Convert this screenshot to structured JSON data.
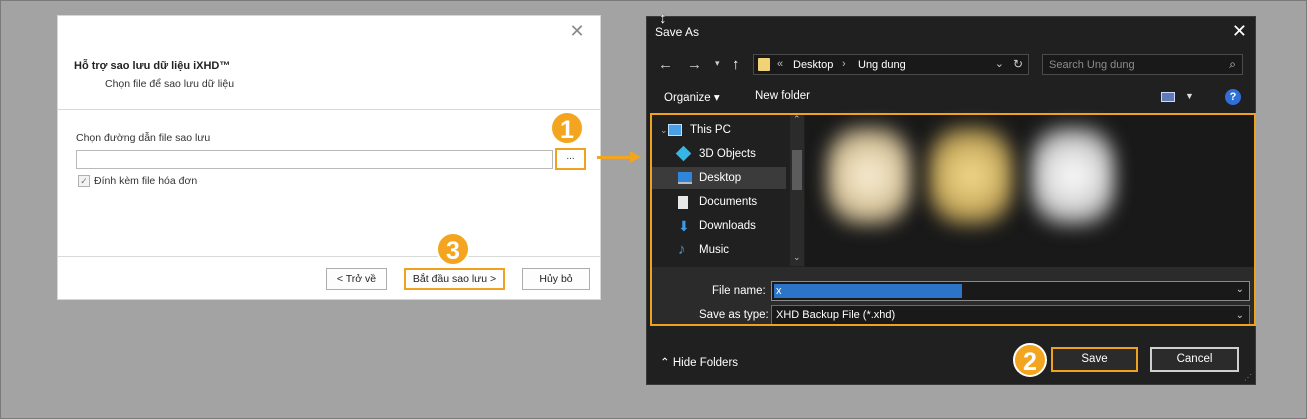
{
  "wizard": {
    "title": "Hỗ trợ sao lưu dữ liệu iXHD™",
    "subtitle": "Chọn file để sao lưu dữ liệu",
    "path_label": "Chọn đường dẫn file sao lưu",
    "path_value": "",
    "browse_label": "...",
    "attach_checked": true,
    "attach_label": "Đính kèm file hóa đơn",
    "back_label": "< Trở về",
    "start_label": "Bắt đầu sao lưu >",
    "cancel_label": "Hủy bỏ"
  },
  "markers": [
    "1",
    "2",
    "3"
  ],
  "dialog": {
    "title": "Save As",
    "breadcrumb": [
      "Desktop",
      "Ung dung"
    ],
    "breadcrumb_prefix": "«",
    "search_placeholder": "Search Ung dung",
    "toolbar": {
      "organize": "Organize ▾",
      "new_folder": "New folder",
      "help": "?"
    },
    "tree": [
      {
        "label": "This PC",
        "icon": "computer-icon"
      },
      {
        "label": "3D Objects",
        "icon": "cube-icon"
      },
      {
        "label": "Desktop",
        "icon": "desktop-icon",
        "selected": true
      },
      {
        "label": "Documents",
        "icon": "document-icon"
      },
      {
        "label": "Downloads",
        "icon": "download-icon"
      },
      {
        "label": "Music",
        "icon": "music-icon"
      }
    ],
    "file_name_label": "File name:",
    "file_name_value": "x",
    "save_type_label": "Save as type:",
    "save_type_value": "XHD Backup File (*.xhd)",
    "hide_folders": "Hide Folders",
    "save_label": "Save",
    "cancel_label": "Cancel"
  },
  "colors": {
    "accent": "#f0a21f",
    "dialog_bg": "#202020",
    "selection": "#2b74c8"
  }
}
